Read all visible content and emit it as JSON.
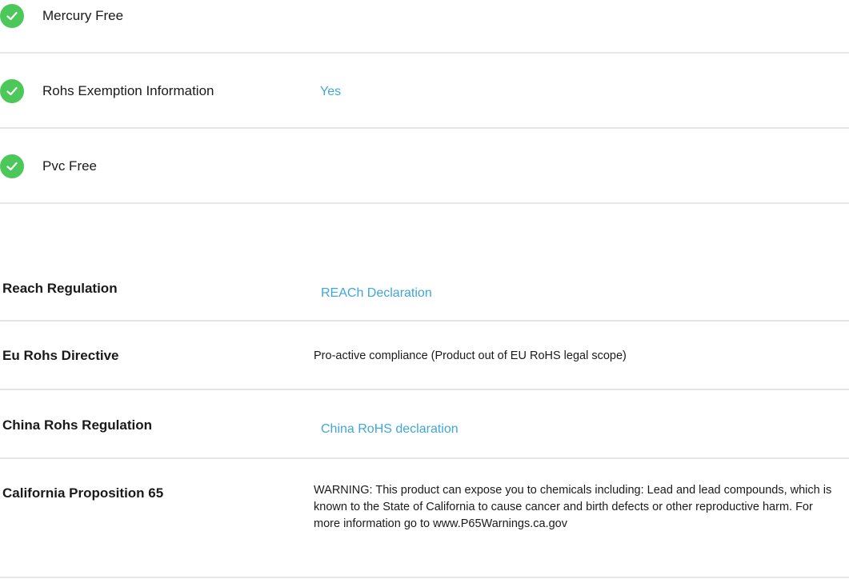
{
  "checklist": [
    {
      "label": "Mercury Free",
      "value": "",
      "icon": "checkmark-icon"
    },
    {
      "label": "Rohs Exemption Information",
      "value": "Yes",
      "icon": "checkmark-icon"
    },
    {
      "label": "Pvc Free",
      "value": "",
      "icon": "checkmark-icon"
    }
  ],
  "regulations": [
    {
      "label": "Reach Regulation",
      "value": "REACh Declaration",
      "is_link": true
    },
    {
      "label": "Eu Rohs Directive",
      "value": "Pro-active compliance (Product out of EU RoHS legal scope)",
      "is_link": false
    },
    {
      "label": "China Rohs Regulation",
      "value": "China RoHS declaration",
      "is_link": true
    },
    {
      "label": "California Proposition 65",
      "value": "WARNING: This product can expose you to chemicals including: Lead and lead compounds, which is known to the State of California to cause cancer and birth defects or other reproductive harm. For more information go to www.P65Warnings.ca.gov",
      "is_link": false
    }
  ],
  "colors": {
    "check_green": "#4cc75a",
    "link_blue": "#3fa7d6",
    "divider": "#e6e6e6"
  }
}
